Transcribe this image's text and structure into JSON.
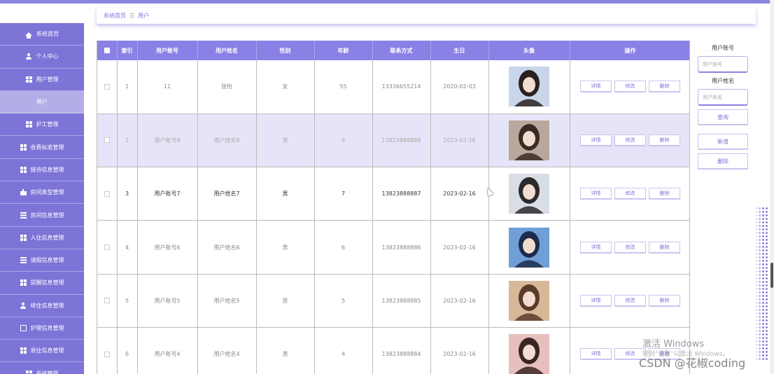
{
  "breadcrumb": {
    "home": "系统首页",
    "separator": "☰",
    "current": "用户"
  },
  "sidebar": {
    "items": [
      {
        "label": "系统首页",
        "icon": "home-icon",
        "kind": "main"
      },
      {
        "label": "个人中心",
        "icon": "user-icon",
        "kind": "main"
      },
      {
        "label": "用户管理",
        "icon": "grid-icon",
        "kind": "main"
      },
      {
        "label": "用户",
        "icon": "",
        "kind": "sub-active"
      },
      {
        "label": "护工管理",
        "icon": "grid-icon",
        "kind": "main"
      },
      {
        "label": "收费标准管理",
        "icon": "grid-icon",
        "kind": "main"
      },
      {
        "label": "接待信息管理",
        "icon": "grid-icon",
        "kind": "main"
      },
      {
        "label": "房间类型管理",
        "icon": "cake-icon",
        "kind": "main"
      },
      {
        "label": "房间信息管理",
        "icon": "list-icon",
        "kind": "main"
      },
      {
        "label": "入住信息管理",
        "icon": "grid-icon",
        "kind": "main"
      },
      {
        "label": "请假信息管理",
        "icon": "list-icon",
        "kind": "main"
      },
      {
        "label": "提醒信息管理",
        "icon": "grid-icon",
        "kind": "main"
      },
      {
        "label": "续住信息管理",
        "icon": "user-icon",
        "kind": "main"
      },
      {
        "label": "护理信息管理",
        "icon": "id-icon",
        "kind": "main"
      },
      {
        "label": "退住信息管理",
        "icon": "grid-icon",
        "kind": "main"
      },
      {
        "label": "系统管理",
        "icon": "grid-icon",
        "kind": "main"
      }
    ]
  },
  "table": {
    "headers": [
      "",
      "索引",
      "用户账号",
      "用户姓名",
      "性别",
      "年龄",
      "联系方式",
      "生日",
      "头像",
      "操作"
    ],
    "actions": {
      "detail": "详情",
      "edit": "修改",
      "delete": "删除"
    },
    "rows": [
      {
        "index": "1",
        "account": "11",
        "name": "张怡",
        "gender": "女",
        "age": "55",
        "phone": "13336655214",
        "birthday": "2020-02-03",
        "style": "normal",
        "avatar_bg": "#c9d6ea",
        "avatar_fg": "#2b2020"
      },
      {
        "index": "2",
        "account": "用户账号8",
        "name": "用户姓名8",
        "gender": "男",
        "age": "8",
        "phone": "13823888888",
        "birthday": "2023-02-16",
        "style": "hover",
        "avatar_bg": "#b9a79c",
        "avatar_fg": "#3a2a25"
      },
      {
        "index": "3",
        "account": "用户账号7",
        "name": "用户姓名7",
        "gender": "男",
        "age": "7",
        "phone": "13823888887",
        "birthday": "2023-02-16",
        "style": "dark",
        "avatar_bg": "#d8dde6",
        "avatar_fg": "#2c2a2c"
      },
      {
        "index": "4",
        "account": "用户账号6",
        "name": "用户姓名6",
        "gender": "男",
        "age": "6",
        "phone": "13823888886",
        "birthday": "2023-02-16",
        "style": "normal",
        "avatar_bg": "#6f9fd6",
        "avatar_fg": "#1d2c4a"
      },
      {
        "index": "5",
        "account": "用户账号5",
        "name": "用户姓名5",
        "gender": "男",
        "age": "5",
        "phone": "13823888885",
        "birthday": "2023-02-16",
        "style": "normal",
        "avatar_bg": "#d7b99a",
        "avatar_fg": "#5a3b2a"
      },
      {
        "index": "6",
        "account": "用户账号4",
        "name": "用户姓名4",
        "gender": "男",
        "age": "4",
        "phone": "13823888884",
        "birthday": "2023-02-16",
        "style": "normal",
        "avatar_bg": "#e7c0bd",
        "avatar_fg": "#3a2424"
      }
    ]
  },
  "search_panel": {
    "account_label": "用户账号",
    "account_placeholder": "用户账号",
    "name_label": "用户姓名",
    "name_placeholder": "用户姓名",
    "query_button": "查询",
    "add_button": "新增",
    "delete_button": "删除"
  },
  "watermark": {
    "line1": "激活 Windows",
    "line2": "转到\"设置\"以激活 Windows。",
    "csdn": "CSDN @花椒coding"
  },
  "colors": {
    "accent": "#7d74d8",
    "header": "#8a81e6",
    "hover_row": "#e6e4f8"
  }
}
